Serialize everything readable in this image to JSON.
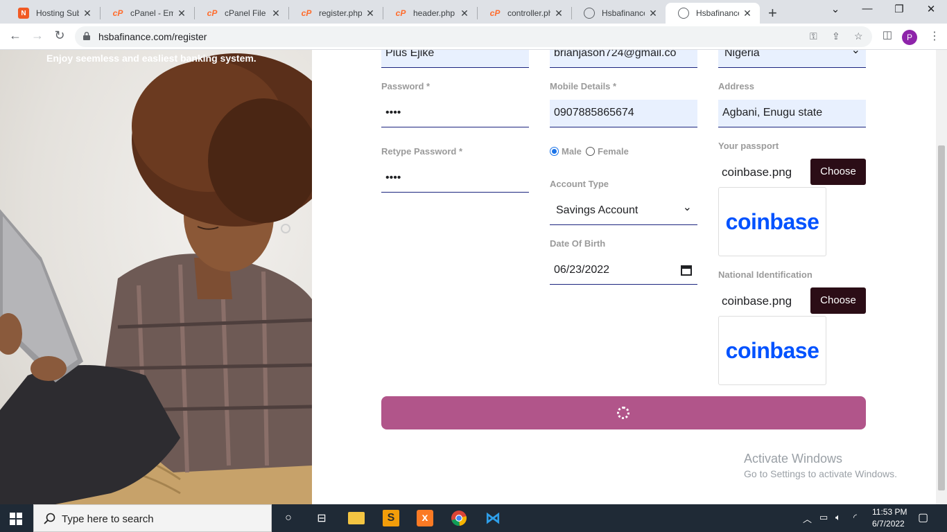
{
  "browser": {
    "tabs": [
      {
        "title": "Hosting Subsc",
        "favicon": "hosting-icon"
      },
      {
        "title": "cPanel - Emai",
        "favicon": "cpanel-icon"
      },
      {
        "title": "cPanel File M",
        "favicon": "cpanel-icon"
      },
      {
        "title": "register.php -",
        "favicon": "cpanel-icon"
      },
      {
        "title": "header.php -",
        "favicon": "cpanel-icon"
      },
      {
        "title": "controller.php",
        "favicon": "cpanel-icon"
      },
      {
        "title": "Hsbafinance /",
        "favicon": "globe-icon"
      },
      {
        "title": "Hsbafinance",
        "favicon": "globe-icon",
        "active": true
      }
    ],
    "url": "hsbafinance.com/register",
    "profile_initial": "P"
  },
  "hero": {
    "tagline": "Enjoy seemless and easliest banking system."
  },
  "form": {
    "full_name_value": "Pius Ejike",
    "email_value": "brianjason724@gmail.co",
    "country_value": "Nigeria",
    "password_label": "Password *",
    "password_value": "••••",
    "mobile_label": "Mobile Details *",
    "mobile_value": "0907885865674",
    "address_label": "Address",
    "address_value": "Agbani, Enugu state",
    "retype_label": "Retype Password *",
    "retype_value": "••••",
    "gender_male": "Male",
    "gender_female": "Female",
    "gender_selected": "Male",
    "account_type_label": "Account Type",
    "account_type_value": "Savings Account",
    "dob_label": "Date Of Birth",
    "dob_value": "06/23/2022",
    "passport_label": "Your passport",
    "passport_file": "coinbase.png",
    "choose_label": "Choose",
    "preview_text": "coinbase",
    "national_id_label": "National Identification",
    "national_id_file": "coinbase.png"
  },
  "watermark": {
    "line1": "Activate Windows",
    "line2": "Go to Settings to activate Windows."
  },
  "taskbar": {
    "search_placeholder": "Type here to search",
    "time": "11:53 PM",
    "date": "6/7/2022"
  },
  "colors": {
    "submit_button": "#b1558a",
    "choose_button": "#2b0d16",
    "field_fill": "#e8f0fe",
    "coinbase_blue": "#0052ff"
  }
}
